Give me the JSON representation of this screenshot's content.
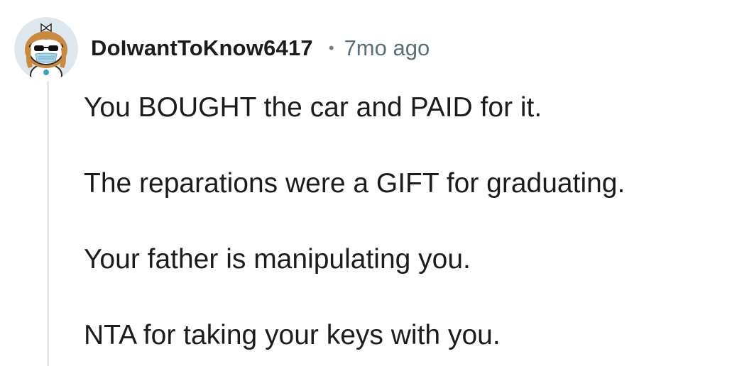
{
  "comment": {
    "username": "DoIwantToKnow6417",
    "separator": "•",
    "timestamp": "7mo ago",
    "avatar_icon": "snoo-avatar-icon",
    "paragraphs": [
      "You BOUGHT the car and PAID for it.",
      "The reparations were a GIFT for graduating.",
      "Your father is manipulating you.",
      "NTA for taking your keys with you."
    ]
  },
  "colors": {
    "text": "#1c1c1c",
    "meta": "#576f76",
    "thread_line": "#e5e7ea",
    "avatar_bg": "#dfe7ee"
  }
}
